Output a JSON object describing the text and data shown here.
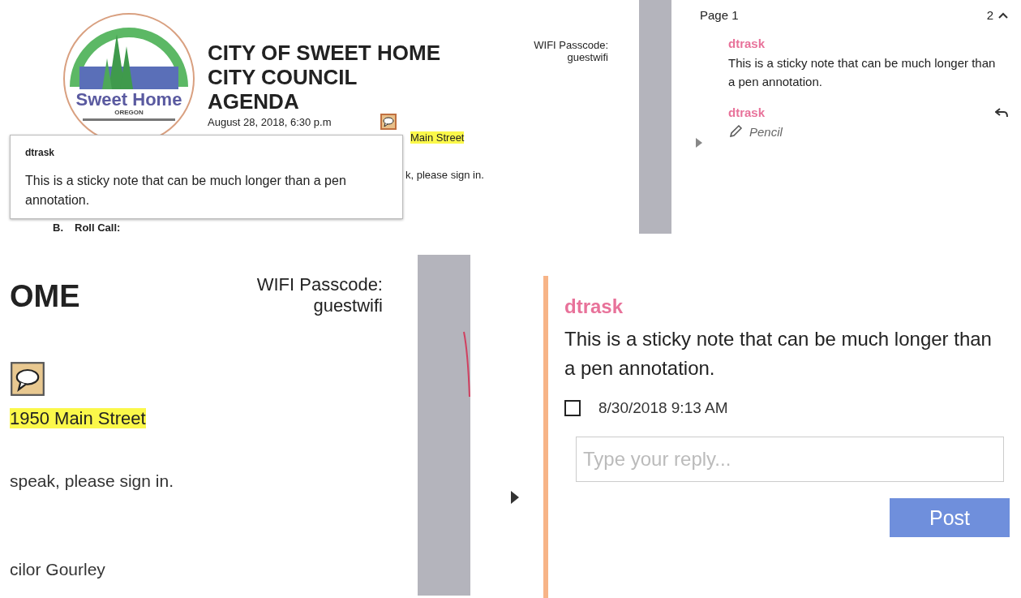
{
  "agenda_page": {
    "logo": {
      "name": "Sweet Home",
      "state": "OREGON"
    },
    "heading": [
      "CITY OF SWEET HOME",
      "CITY COUNCIL",
      "AGENDA"
    ],
    "date": "August 28, 2018, 6:30 p.m",
    "address": "Main Street",
    "sign_in": "k, please sign in.",
    "roll_call": {
      "letter": "B.",
      "label": "Roll Call:"
    },
    "popup": {
      "author": "dtrask",
      "text": "This is a sticky note that can be much longer than a pen annotation."
    }
  },
  "wifi_top": {
    "label": "WIFI Passcode:",
    "value": "guestwifi"
  },
  "comments_pane": {
    "page": "Page 1",
    "count": "2",
    "comments": [
      {
        "kind": "note",
        "author": "dtrask",
        "text": "This is a sticky note that can be much longer than a pen annotation."
      },
      {
        "kind": "ink",
        "author": "dtrask",
        "label": "Pencil"
      }
    ]
  },
  "zoomed_page": {
    "heading": "OME",
    "wifi": {
      "label": "WIFI Passcode:",
      "value": "guestwifi"
    },
    "address": "1950 Main Street",
    "sign_in": "speak, please sign in.",
    "councilor": "cilor Gourley"
  },
  "zoomed_comment": {
    "author": "dtrask",
    "text": "This is a sticky note that can be much longer than a pen annotation.",
    "checked": false,
    "date": "8/30/2018  9:13 AM",
    "reply": {
      "placeholder": "Type your reply..."
    },
    "post": "Post"
  }
}
